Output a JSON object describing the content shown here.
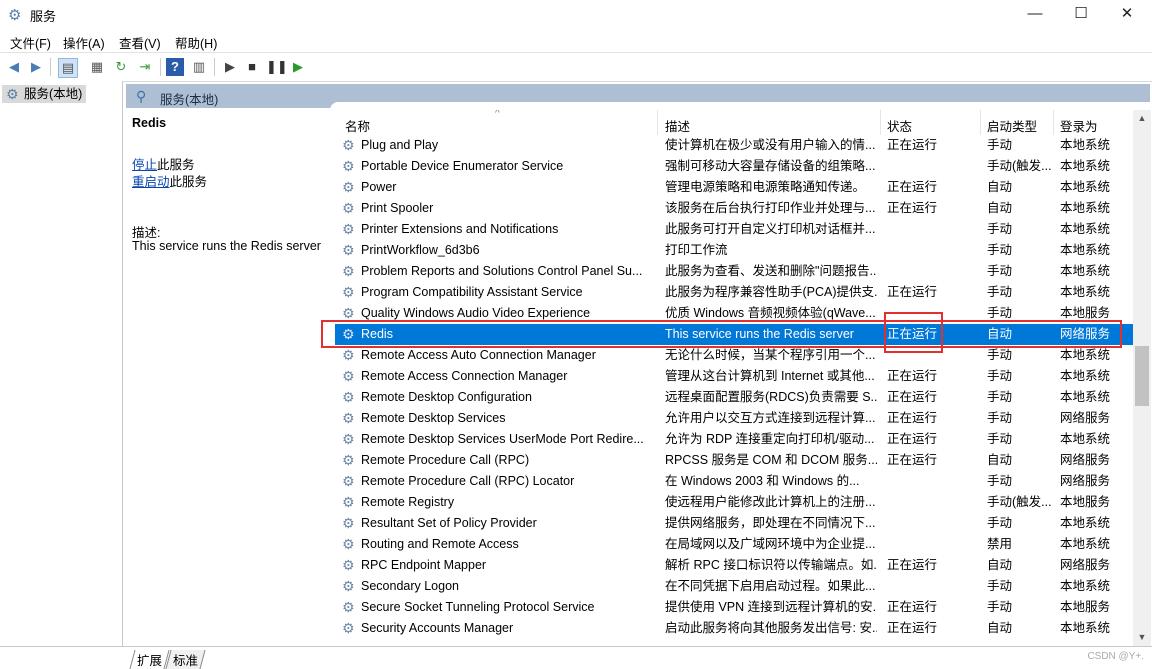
{
  "window": {
    "title": "服务",
    "controls": {
      "minimize": "—",
      "maximize": "☐",
      "close": "✕"
    }
  },
  "menu": [
    "文件(F)",
    "操作(A)",
    "查看(V)",
    "帮助(H)"
  ],
  "toolbar_icons": [
    "back-arrow-icon",
    "forward-arrow-icon",
    "show-hide-tree-icon",
    "properties-icon",
    "refresh-icon",
    "export-list-icon",
    "help-icon",
    "view-icon",
    "start-service-icon",
    "stop-service-icon",
    "pause-service-icon",
    "restart-service-icon"
  ],
  "tree": {
    "label": "服务(本地)"
  },
  "pane": {
    "header": "服务(本地)"
  },
  "detail": {
    "title": "Redis",
    "stop_link": "停止",
    "stop_suffix": "此服务",
    "restart_link": "重启动",
    "restart_suffix": "此服务",
    "desc_label": "描述:",
    "desc_text": "This service runs the Redis server"
  },
  "columns": {
    "name": "名称",
    "desc": "描述",
    "status": "状态",
    "startup": "启动类型",
    "logon": "登录为"
  },
  "rows": [
    {
      "name": "Plug and Play",
      "desc": "使计算机在极少或没有用户输入的情...",
      "status": "正在运行",
      "startup": "手动",
      "logon": "本地系统"
    },
    {
      "name": "Portable Device Enumerator Service",
      "desc": "强制可移动大容量存储设备的组策略...",
      "status": "",
      "startup": "手动(触发...",
      "logon": "本地系统"
    },
    {
      "name": "Power",
      "desc": "管理电源策略和电源策略通知传递。",
      "status": "正在运行",
      "startup": "自动",
      "logon": "本地系统"
    },
    {
      "name": "Print Spooler",
      "desc": "该服务在后台执行打印作业并处理与...",
      "status": "正在运行",
      "startup": "自动",
      "logon": "本地系统"
    },
    {
      "name": "Printer Extensions and Notifications",
      "desc": "此服务可打开自定义打印机对话框并...",
      "status": "",
      "startup": "手动",
      "logon": "本地系统"
    },
    {
      "name": "PrintWorkflow_6d3b6",
      "desc": "打印工作流",
      "status": "",
      "startup": "手动",
      "logon": "本地系统"
    },
    {
      "name": "Problem Reports and Solutions Control Panel Su...",
      "desc": "此服务为查看、发送和删除\"问题报告...",
      "status": "",
      "startup": "手动",
      "logon": "本地系统"
    },
    {
      "name": "Program Compatibility Assistant Service",
      "desc": "此服务为程序兼容性助手(PCA)提供支...",
      "status": "正在运行",
      "startup": "手动",
      "logon": "本地系统"
    },
    {
      "name": "Quality Windows Audio Video Experience",
      "desc": "优质 Windows 音频视频体验(qWave...",
      "status": "",
      "startup": "手动",
      "logon": "本地服务"
    },
    {
      "name": "Redis",
      "desc": "This service runs the Redis server",
      "status": "正在运行",
      "startup": "自动",
      "logon": "网络服务",
      "selected": true
    },
    {
      "name": "Remote Access Auto Connection Manager",
      "desc": "无论什么时候，当某个程序引用一个...",
      "status": "",
      "startup": "手动",
      "logon": "本地系统"
    },
    {
      "name": "Remote Access Connection Manager",
      "desc": "管理从这台计算机到 Internet 或其他...",
      "status": "正在运行",
      "startup": "手动",
      "logon": "本地系统"
    },
    {
      "name": "Remote Desktop Configuration",
      "desc": "远程桌面配置服务(RDCS)负责需要 S...",
      "status": "正在运行",
      "startup": "手动",
      "logon": "本地系统"
    },
    {
      "name": "Remote Desktop Services",
      "desc": "允许用户以交互方式连接到远程计算...",
      "status": "正在运行",
      "startup": "手动",
      "logon": "网络服务"
    },
    {
      "name": "Remote Desktop Services UserMode Port Redire...",
      "desc": "允许为 RDP 连接重定向打印机/驱动...",
      "status": "正在运行",
      "startup": "手动",
      "logon": "本地系统"
    },
    {
      "name": "Remote Procedure Call (RPC)",
      "desc": "RPCSS 服务是 COM 和 DCOM 服务...",
      "status": "正在运行",
      "startup": "自动",
      "logon": "网络服务"
    },
    {
      "name": "Remote Procedure Call (RPC) Locator",
      "desc": "在 Windows 2003 和 Windows 的...",
      "status": "",
      "startup": "手动",
      "logon": "网络服务"
    },
    {
      "name": "Remote Registry",
      "desc": "使远程用户能修改此计算机上的注册...",
      "status": "",
      "startup": "手动(触发...",
      "logon": "本地服务"
    },
    {
      "name": "Resultant Set of Policy Provider",
      "desc": "提供网络服务，即处理在不同情况下...",
      "status": "",
      "startup": "手动",
      "logon": "本地系统"
    },
    {
      "name": "Routing and Remote Access",
      "desc": "在局域网以及广域网环境中为企业提...",
      "status": "",
      "startup": "禁用",
      "logon": "本地系统"
    },
    {
      "name": "RPC Endpoint Mapper",
      "desc": "解析 RPC 接口标识符以传输端点。如...",
      "status": "正在运行",
      "startup": "自动",
      "logon": "网络服务"
    },
    {
      "name": "Secondary Logon",
      "desc": "在不同凭据下启用启动过程。如果此...",
      "status": "",
      "startup": "手动",
      "logon": "本地系统"
    },
    {
      "name": "Secure Socket Tunneling Protocol Service",
      "desc": "提供使用 VPN 连接到远程计算机的安...",
      "status": "正在运行",
      "startup": "手动",
      "logon": "本地服务"
    },
    {
      "name": "Security Accounts Manager",
      "desc": "启动此服务将向其他服务发出信号: 安...",
      "status": "正在运行",
      "startup": "自动",
      "logon": "本地系统"
    }
  ],
  "bottom_tabs": [
    "扩展",
    "标准"
  ],
  "watermark": "CSDN @Y+."
}
